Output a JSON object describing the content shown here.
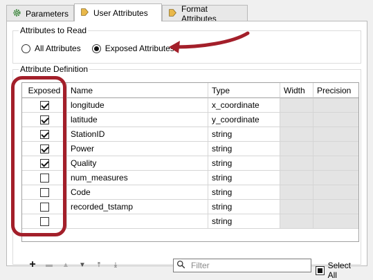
{
  "tabs": [
    {
      "label": "Parameters",
      "icon": "gear-icon"
    },
    {
      "label": "User Attributes",
      "icon": "pentagon-arrow-icon"
    },
    {
      "label": "Format Attributes",
      "icon": "pentagon-arrow-icon"
    }
  ],
  "attributes_to_read": {
    "title": "Attributes to Read",
    "options": [
      {
        "label": "All Attributes",
        "selected": false
      },
      {
        "label": "Exposed Attributes",
        "selected": true
      }
    ]
  },
  "attribute_definition": {
    "title": "Attribute Definition",
    "columns": [
      "Exposed",
      "Name",
      "Type",
      "Width",
      "Precision"
    ],
    "rows": [
      {
        "exposed": true,
        "name": "longitude",
        "type": "x_coordinate"
      },
      {
        "exposed": true,
        "name": "latitude",
        "type": "y_coordinate"
      },
      {
        "exposed": true,
        "name": "StationID",
        "type": "string"
      },
      {
        "exposed": true,
        "name": "Power",
        "type": "string"
      },
      {
        "exposed": true,
        "name": "Quality",
        "type": "string"
      },
      {
        "exposed": false,
        "name": "num_measures",
        "type": "string"
      },
      {
        "exposed": false,
        "name": "Code",
        "type": "string"
      },
      {
        "exposed": false,
        "name": "recorded_tstamp",
        "type": "string"
      },
      {
        "exposed": false,
        "name": "",
        "type": "string"
      }
    ]
  },
  "toolbar": {
    "filter_placeholder": "Filter",
    "select_all_label": "Select All"
  },
  "colors": {
    "annotation": "#a31f2a",
    "readonly_cell": "#e4e4e4"
  }
}
